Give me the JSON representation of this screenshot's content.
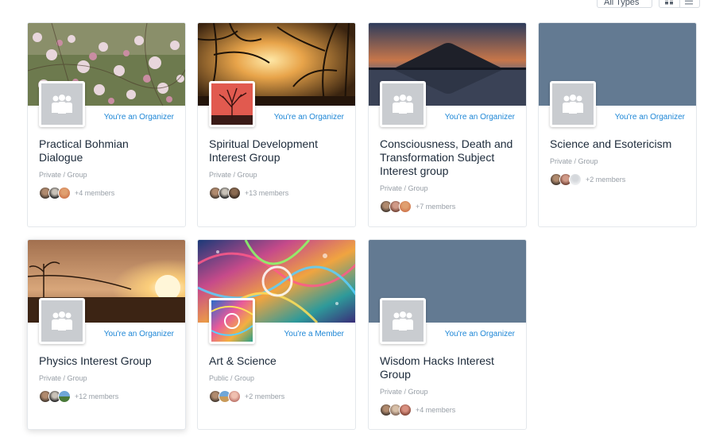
{
  "toolbar": {
    "filter_value": "All Types",
    "grid_view_icon": "grid-icon",
    "list_view_icon": "list-icon"
  },
  "groups": [
    {
      "title": "Practical Bohmian Dialogue",
      "meta": "Private / Group",
      "members": "+4 members",
      "role": "You're an Organizer",
      "avatar": "group-placeholder-icon",
      "cover": "flowering-tree-photo"
    },
    {
      "title": "Spiritual Development Interest Group",
      "meta": "Private / Group",
      "members": "+13 members",
      "role": "You're an Organizer",
      "avatar": "red-tree-image",
      "cover": "sunset-through-trees-photo"
    },
    {
      "title": "Consciousness, Death and Transformation Subject Interest group",
      "meta": "Private / Group",
      "members": "+7 members",
      "role": "You're an Organizer",
      "avatar": "group-placeholder-icon",
      "cover": "mountain-lake-dusk-photo"
    },
    {
      "title": "Science and Esotericism",
      "meta": "Private / Group",
      "members": "+2 members",
      "role": "You're an Organizer",
      "avatar": "group-placeholder-icon",
      "cover": "slate-blue-placeholder"
    },
    {
      "title": "Physics Interest Group",
      "meta": "Private / Group",
      "members": "+12 members",
      "role": "You're an Organizer",
      "avatar": "group-placeholder-icon",
      "cover": "hazy-sunset-photo"
    },
    {
      "title": "Art & Science",
      "meta": "Public / Group",
      "members": "+2 members",
      "role": "You're a Member",
      "avatar": "psychedelic-art-image",
      "cover": "psychedelic-art-photo"
    },
    {
      "title": "Wisdom Hacks Interest Group",
      "meta": "Private / Group",
      "members": "+4 members",
      "role": "You're an Organizer",
      "avatar": "group-placeholder-icon",
      "cover": "slate-blue-placeholder"
    }
  ],
  "colors": {
    "accent": "#1d86d6",
    "title": "#1c2a3a",
    "muted": "#979ea6",
    "placeholder_cover": "#637a92",
    "placeholder_avatar": "#c9ccd0"
  }
}
